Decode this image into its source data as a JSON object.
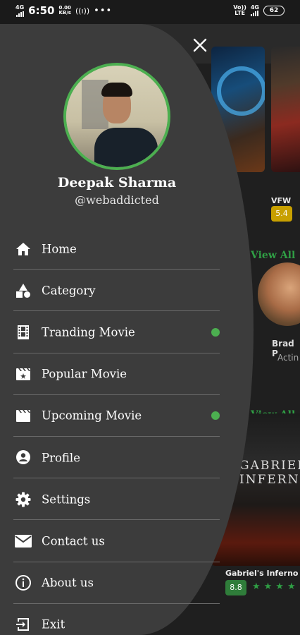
{
  "status_bar": {
    "network_left": "4G",
    "time": "6:50",
    "data_speed": "0.00",
    "data_unit": "KB/s",
    "dots": "•••",
    "vo_lte_top": "Vo))",
    "vo_lte_bottom": "LTE",
    "network_right": "4G",
    "battery": "62"
  },
  "drawer": {
    "close_icon": "close-icon",
    "user": {
      "name": "Deepak Sharma",
      "handle": "@webaddicted"
    },
    "accent_color": "#4caf50",
    "menu": [
      {
        "label": "Home",
        "icon": "home-icon",
        "dot": false
      },
      {
        "label": "Category",
        "icon": "category-icon",
        "dot": false
      },
      {
        "label": "Tranding Movie",
        "icon": "film-icon",
        "dot": true
      },
      {
        "label": "Popular Movie",
        "icon": "clapper-sparkle-icon",
        "dot": false
      },
      {
        "label": "Upcoming Movie",
        "icon": "clapper-icon",
        "dot": true
      },
      {
        "label": "Profile",
        "icon": "profile-icon",
        "dot": false
      },
      {
        "label": "Settings",
        "icon": "settings-icon",
        "dot": false
      },
      {
        "label": "Contact us",
        "icon": "mail-icon",
        "dot": false
      },
      {
        "label": "About us",
        "icon": "info-icon",
        "dot": false
      },
      {
        "label": "Exit",
        "icon": "exit-icon",
        "dot": false
      }
    ]
  },
  "background": {
    "movie_title": "VFW",
    "movie_rating": "5.4",
    "view_all_1": "View All",
    "actor_name": "Brad P",
    "actor_role": "Actin",
    "view_all_2": "View All",
    "poster_text_1": "GABRIEL",
    "poster_text_2": "INFERNO",
    "movie2_title": "Gabriel's Inferno",
    "movie2_rating": "8.8",
    "stars": "★★★★"
  }
}
